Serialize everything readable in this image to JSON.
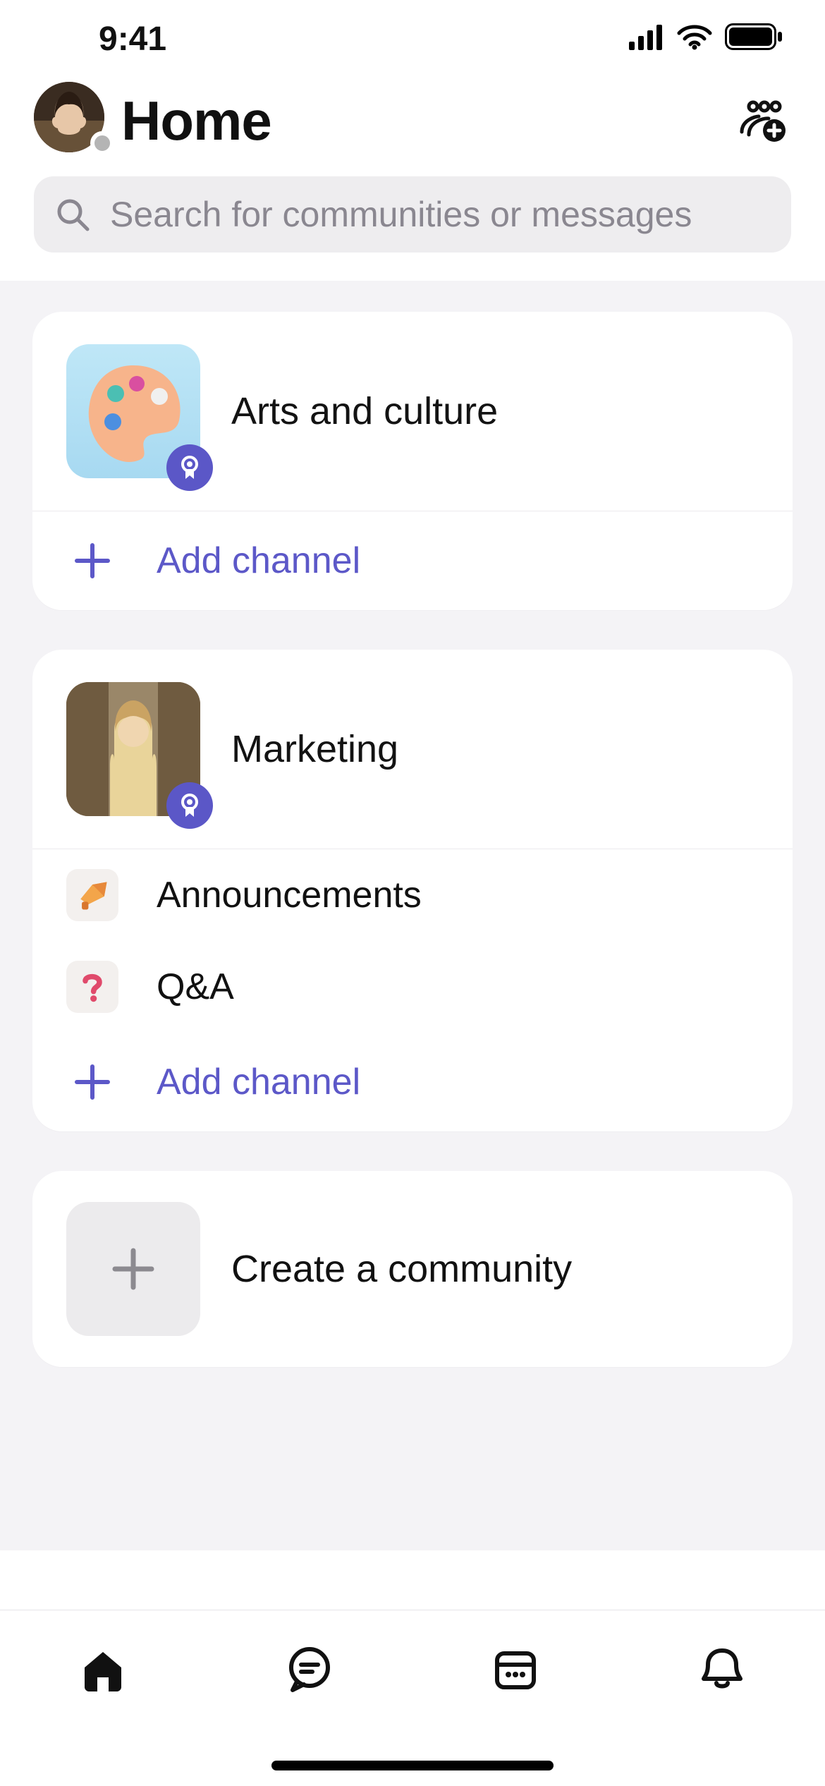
{
  "status": {
    "time": "9:41"
  },
  "header": {
    "title": "Home"
  },
  "search": {
    "placeholder": "Search for communities or messages"
  },
  "communities": [
    {
      "name": "Arts and culture",
      "thumb_kind": "arts",
      "channels": [],
      "add_channel_label": "Add channel"
    },
    {
      "name": "Marketing",
      "thumb_kind": "marketing",
      "channels": [
        {
          "name": "Announcements",
          "icon": "megaphone"
        },
        {
          "name": "Q&A",
          "icon": "question"
        }
      ],
      "add_channel_label": "Add channel"
    }
  ],
  "create_label": "Create a community",
  "tabs": [
    "home",
    "chat",
    "calendar",
    "activity"
  ],
  "accent_color": "#5c58c8"
}
